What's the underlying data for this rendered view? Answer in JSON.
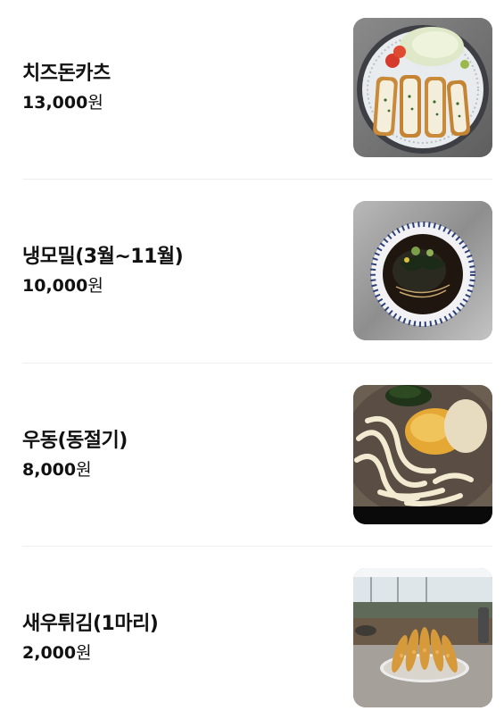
{
  "menu": {
    "items": [
      {
        "name": "치즈돈카츠",
        "price": "13,000",
        "unit": "원"
      },
      {
        "name": "냉모밀(3월~11월)",
        "price": "10,000",
        "unit": "원"
      },
      {
        "name": "우동(동절기)",
        "price": "8,000",
        "unit": "원"
      },
      {
        "name": "새우튀김(1마리)",
        "price": "2,000",
        "unit": "원"
      }
    ]
  },
  "colors": {
    "text": "#111111",
    "divider": "#eeeeee",
    "background": "#ffffff"
  }
}
